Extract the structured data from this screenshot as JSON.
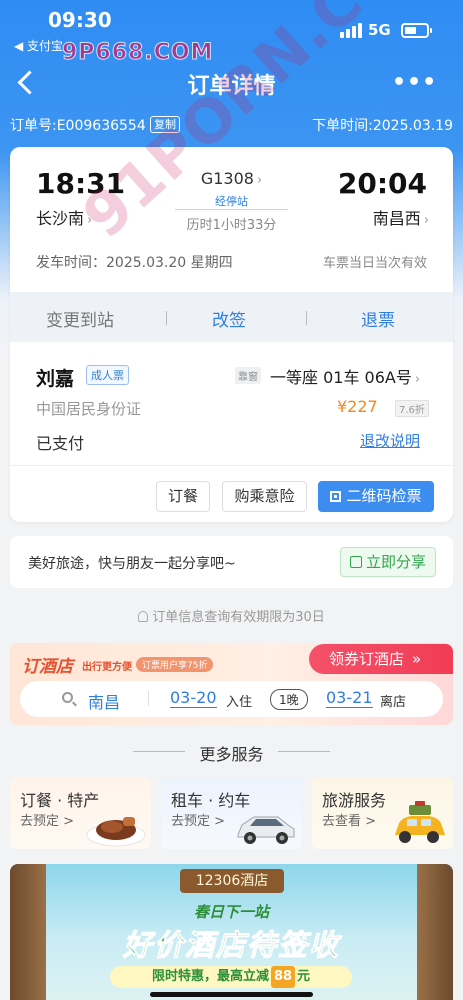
{
  "status_bar": {
    "time": "09:30",
    "back_app": "◀ 支付宝",
    "network": "5G"
  },
  "watermark": {
    "logo_text": "9P668.COM",
    "diagonal_text": "91PORN.COM"
  },
  "nav": {
    "title": "订单详情",
    "more": "•••"
  },
  "order": {
    "number": "订单号:E009636554",
    "copy_label": "复制",
    "order_time": "下单时间:2025.03.19"
  },
  "trip": {
    "depart_time": "18:31",
    "depart_station": "长沙南",
    "arrive_time": "20:04",
    "arrive_station": "南昌西",
    "train_no": "G1308",
    "via_label": "经停站",
    "duration": "历时1小时33分",
    "depart_date": "发车时间：2025.03.20 星期四",
    "validity": "车票当日当次有效"
  },
  "actions": {
    "change_station": "变更到站",
    "resign": "改签",
    "refund": "退票"
  },
  "passenger": {
    "name": "刘嘉",
    "ticket_type": "成人票",
    "window_tag": "靠窗",
    "seat": "一等座 01车 06A号",
    "id_type": "中国居民身份证",
    "price": "¥227",
    "discount": "7.6折",
    "pay_status": "已支付",
    "refund_info": "退改说明"
  },
  "buttons": {
    "meal": "订餐",
    "insurance": "购乘意险",
    "qr_check": "二维码检票"
  },
  "share": {
    "text": "美好旅途，快与朋友一起分享吧~",
    "button": "立即分享"
  },
  "notice": "订单信息查询有效期限为30日",
  "hotel": {
    "title": "订酒店",
    "slogan": "出行更方便",
    "promo": "订票用户享75折",
    "coupon": "领券订酒店",
    "city": "南昌",
    "checkin_date": "03-20",
    "checkin_label": "入住",
    "nights": "1晚",
    "checkout_date": "03-21",
    "checkout_label": "离店"
  },
  "more_services": {
    "heading": "更多服务",
    "items": [
      {
        "title": "订餐 · 特产",
        "sub": "去预定 >",
        "icon": "steak-icon"
      },
      {
        "title": "租车 · 约车",
        "sub": "去预定 >",
        "icon": "car-icon"
      },
      {
        "title": "旅游服务",
        "sub": "去查看 >",
        "icon": "tour-car-icon"
      }
    ]
  },
  "banner": {
    "tag": "12306酒店",
    "subtitle": "春日下一站",
    "headline": "好价酒店待签收",
    "deal_prefix": "限时特惠，最高立减",
    "deal_amount": "88",
    "deal_suffix": "元"
  },
  "colors": {
    "primary_blue": "#2f8cf3",
    "link_blue": "#2f7fe0",
    "price_orange": "#f08a1c",
    "share_green": "#2fa84b",
    "coupon_red": "#f13c55"
  }
}
